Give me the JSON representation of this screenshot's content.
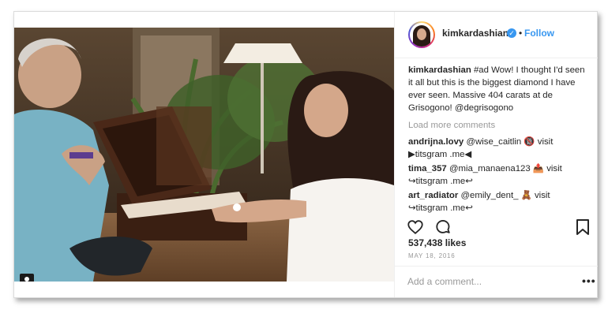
{
  "post": {
    "username": "kimkardashian",
    "follow_separator": "•",
    "follow_label": "Follow",
    "caption_user": "kimkardashian",
    "caption_text": "#ad Wow! I thought I'd seen it all but this is the biggest diamond I have ever seen. Massive 404 carats at de Grisogono! @degrisogono",
    "load_more": "Load more comments",
    "comments": [
      {
        "user": "andrijna.lovy",
        "text": "@wise_caitlin 🔞 visit ▶titsgram .me◀"
      },
      {
        "user": "tima_357",
        "text": "@mia_manaena123 📤 visit ↪titsgram .me↩"
      },
      {
        "user": "art_radiator",
        "text": "@emily_dent_ 🧸 visit ↪titsgram .me↩"
      }
    ],
    "likes": "537,438 likes",
    "date": "MAY 18, 2016",
    "add_comment_placeholder": "Add a comment...",
    "more_label": "•••"
  },
  "icons": {
    "heart": "heart-icon",
    "comment": "comment-icon",
    "bookmark": "bookmark-icon",
    "verified": "verified-badge-icon",
    "user_tag": "user-tag-icon"
  },
  "colors": {
    "link_blue": "#3897f0",
    "muted": "#999999",
    "text": "#262626",
    "border": "#dbdbdb"
  }
}
